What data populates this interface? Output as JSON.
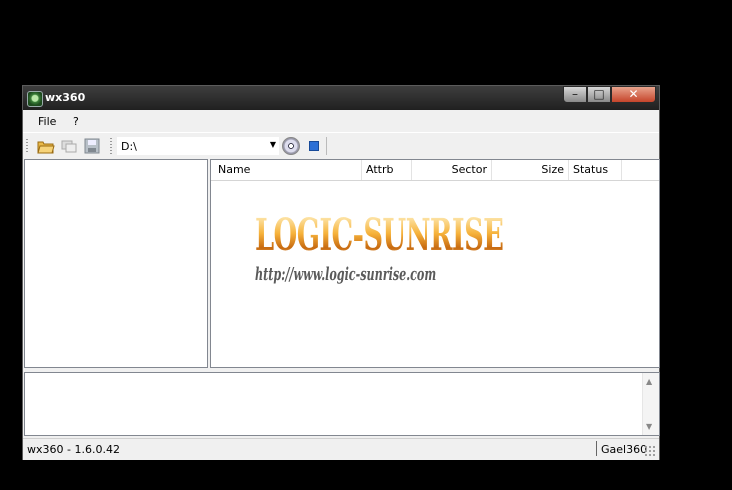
{
  "window": {
    "title": "wx360",
    "minimize_glyph": "–",
    "maximize_glyph": "□",
    "close_glyph": "✕"
  },
  "menu": {
    "items": [
      "File",
      "?"
    ]
  },
  "toolbar": {
    "drive_value": "D:\\",
    "icons": [
      "open-folder-icon",
      "copy-icon",
      "save-icon",
      "disc-icon",
      "stop-icon"
    ]
  },
  "file_list": {
    "columns": [
      "Name",
      "Attrb",
      "Sector",
      "Size",
      "Status"
    ]
  },
  "logo": {
    "title": "LOGIC-SUNRISE",
    "url": "http://www.logic-sunrise.com"
  },
  "statusbar": {
    "version": "wx360 - 1.6.0.42",
    "author": "Gael360"
  },
  "colors": {
    "accent_stop": "#2b6fd6",
    "close_button": "#c5442a",
    "logo_gold": "#f6b23a"
  }
}
